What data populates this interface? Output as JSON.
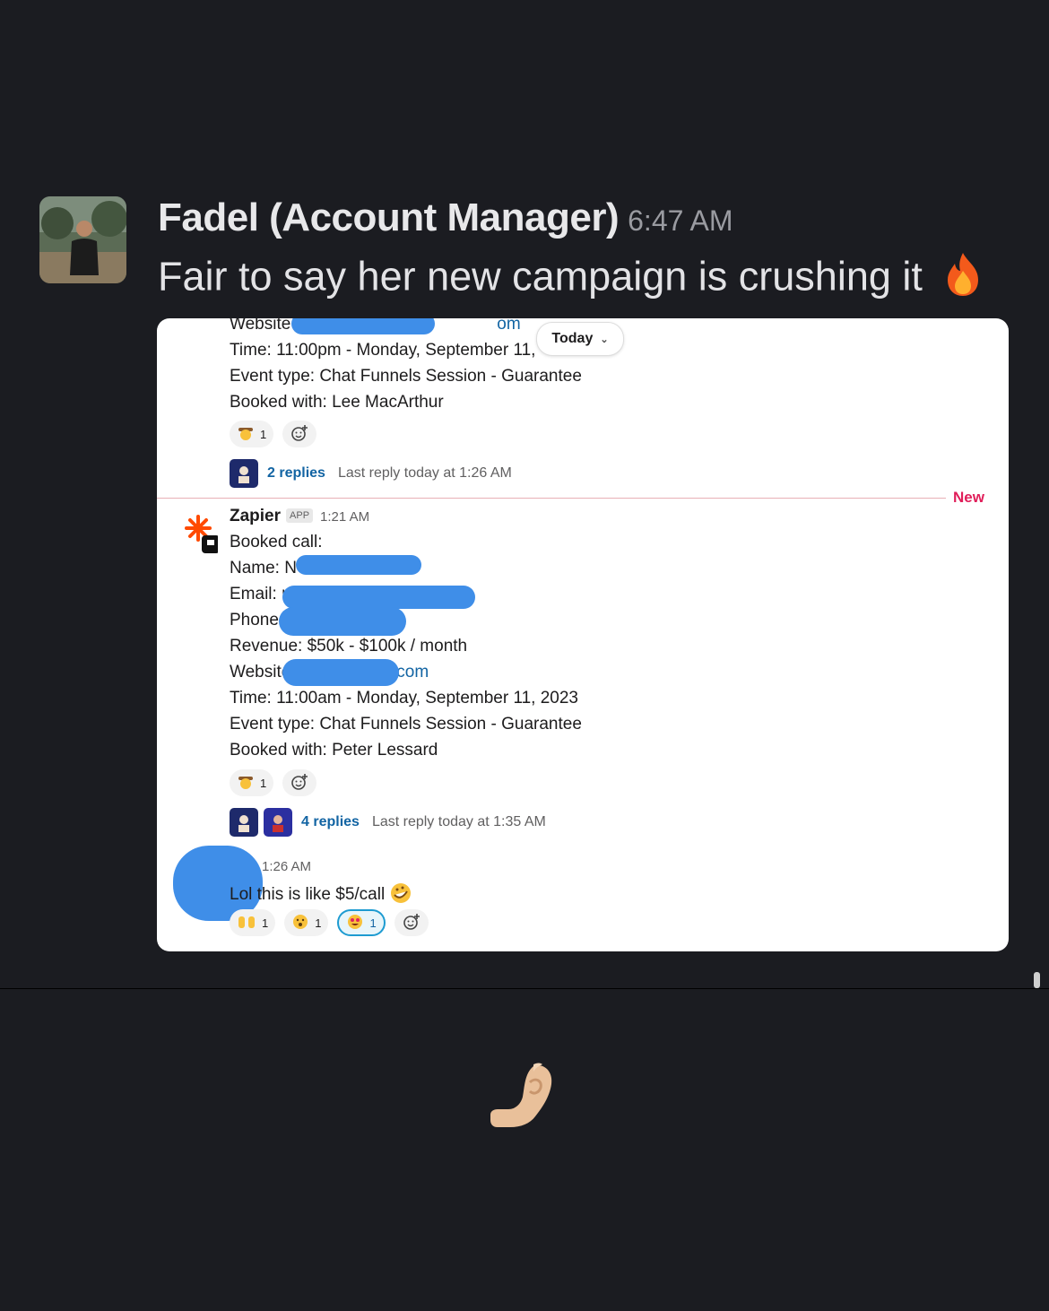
{
  "post": {
    "sender": "Fadel (Account Manager)",
    "time": "6:47 AM",
    "message": "Fair to say her new campaign is crushing it",
    "message_emoji": "fire-emoji"
  },
  "screenshot": {
    "date_pill": "Today",
    "new_divider_label": "New",
    "msg1": {
      "website_label": "Website",
      "website_suffix": "om",
      "time_line": "Time: 11:00pm - Monday, September 11,",
      "event_type": "Event type: Chat Funnels Session - Guarantee",
      "booked_with": "Booked with: Lee MacArthur",
      "reaction_count": "1",
      "replies": "2 replies",
      "last_reply": "Last reply today at 1:26 AM"
    },
    "msg2": {
      "sender": "Zapier",
      "badge": "APP",
      "time": "1:21 AM",
      "title": "Booked call:",
      "name_label": "Name: N",
      "email_label": "Email: r",
      "phone_label": "Phone",
      "revenue": "Revenue: $50k - $100k / month",
      "website_label": "Website",
      "website_suffix": "com",
      "time_line": "Time: 11:00am - Monday, September 11, 2023",
      "event_type": "Event type: Chat Funnels Session - Guarantee",
      "booked_with": "Booked with: Peter Lessard",
      "reaction_count": "1",
      "replies": "4 replies",
      "last_reply": "Last reply today at 1:35 AM"
    },
    "msg3": {
      "time": "1:26 AM",
      "text": "Lol this is like $5/call",
      "reactions": [
        {
          "icon": "raised-hands-emoji",
          "count": "1"
        },
        {
          "icon": "astonished-face-emoji",
          "count": "1"
        },
        {
          "icon": "heart-eyes-emoji",
          "count": "1"
        }
      ]
    }
  },
  "footer": {
    "reaction_icon": "pinched-fingers-emoji"
  }
}
